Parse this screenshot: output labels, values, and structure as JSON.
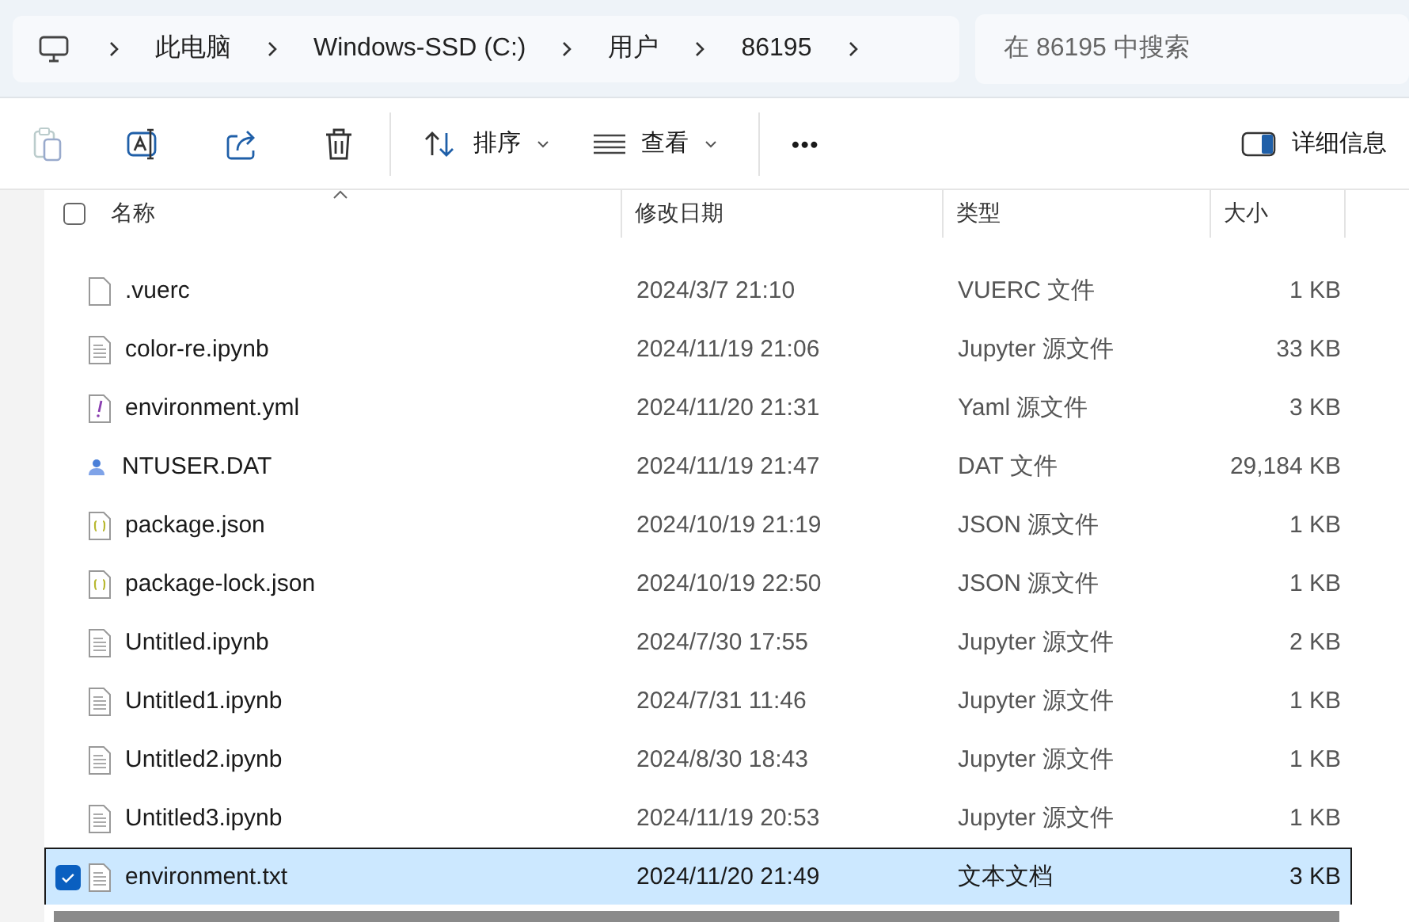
{
  "address_bar": {
    "crumbs": [
      "此电脑",
      "Windows-SSD (C:)",
      "用户",
      "86195"
    ]
  },
  "search": {
    "placeholder": "在 86195 中搜索"
  },
  "toolbar": {
    "sort": "排序",
    "view": "查看",
    "more": "•••",
    "details": "详细信息"
  },
  "select_all": {
    "checked": false
  },
  "columns": [
    "名称",
    "修改日期",
    "类型",
    "大小"
  ],
  "rows": [
    {
      "kind": "blank",
      "name": ".vuerc",
      "date": "2024/3/7 21:10",
      "type": "VUERC 文件",
      "size": "1 KB",
      "selected": false
    },
    {
      "kind": "text",
      "name": "color-re.ipynb",
      "date": "2024/11/19 21:06",
      "type": "Jupyter 源文件",
      "size": "33 KB",
      "selected": false
    },
    {
      "kind": "yaml",
      "name": "environment.yml",
      "date": "2024/11/20 21:31",
      "type": "Yaml 源文件",
      "size": "3 KB",
      "selected": false
    },
    {
      "kind": "user",
      "name": "NTUSER.DAT",
      "date": "2024/11/19 21:47",
      "type": "DAT 文件",
      "size": "29,184 KB",
      "selected": false
    },
    {
      "kind": "json",
      "name": "package.json",
      "date": "2024/10/19 21:19",
      "type": "JSON 源文件",
      "size": "1 KB",
      "selected": false
    },
    {
      "kind": "json",
      "name": "package-lock.json",
      "date": "2024/10/19 22:50",
      "type": "JSON 源文件",
      "size": "1 KB",
      "selected": false
    },
    {
      "kind": "text",
      "name": "Untitled.ipynb",
      "date": "2024/7/30 17:55",
      "type": "Jupyter 源文件",
      "size": "2 KB",
      "selected": false
    },
    {
      "kind": "text",
      "name": "Untitled1.ipynb",
      "date": "2024/7/31 11:46",
      "type": "Jupyter 源文件",
      "size": "1 KB",
      "selected": false
    },
    {
      "kind": "text",
      "name": "Untitled2.ipynb",
      "date": "2024/8/30 18:43",
      "type": "Jupyter 源文件",
      "size": "1 KB",
      "selected": false
    },
    {
      "kind": "text",
      "name": "Untitled3.ipynb",
      "date": "2024/11/19 20:53",
      "type": "Jupyter 源文件",
      "size": "1 KB",
      "selected": false
    },
    {
      "kind": "text",
      "name": "environment.txt",
      "date": "2024/11/20 21:49",
      "type": "文本文档",
      "size": "3 KB",
      "selected": true
    }
  ]
}
